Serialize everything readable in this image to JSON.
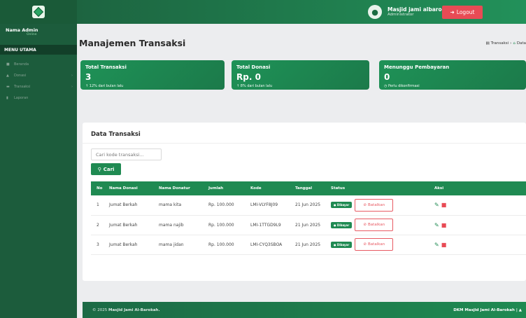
{
  "topbar": {
    "user_name": "Masjid jami albarok...",
    "user_role": "Administrator",
    "logout_label": "Logout"
  },
  "sidebar": {
    "user_panel_name": "Nama Admin",
    "user_panel_status": "Online",
    "menu_header": "MENU UTAMA",
    "items": [
      {
        "label": "Beranda",
        "icon": "dashboard-icon"
      },
      {
        "label": "Donasi",
        "icon": "donation-icon"
      },
      {
        "label": "Transaksi",
        "icon": "transaction-icon"
      },
      {
        "label": "Laporan",
        "icon": "report-icon"
      }
    ]
  },
  "page": {
    "title": "Manajemen Transaksi",
    "breadcrumb": [
      "Transaksi",
      "Data"
    ]
  },
  "cards": [
    {
      "title": "Total Transaksi",
      "value": "3",
      "note": "12% dari bulan lalu"
    },
    {
      "title": "Total Donasi",
      "value": "Rp. 0",
      "note": "8% dari bulan lalu"
    },
    {
      "title": "Menunggu Pembayaran",
      "value": "0",
      "note": "Perlu dikonfirmasi"
    }
  ],
  "panel": {
    "title": "Data Transaksi",
    "search_placeholder": "Cari kode transaksi...",
    "search_button": "Cari"
  },
  "table": {
    "headers": [
      "No",
      "Nama Donasi",
      "Nama Donatur",
      "Jumlah",
      "Kode",
      "Tanggal",
      "Status",
      "Aksi"
    ],
    "rows": [
      {
        "no": "1",
        "donasi": "Jumat Berkah",
        "donatur": "mama kita",
        "jumlah": "Rp. 100.000",
        "kode": "LMI-VLYF8J09",
        "tanggal": "21 Jun 2025",
        "status": "Dibayar",
        "cancel": "Batalkan"
      },
      {
        "no": "2",
        "donasi": "Jumat Berkah",
        "donatur": "mama najib",
        "jumlah": "Rp. 100.000",
        "kode": "LMI-1TTGD9L9",
        "tanggal": "21 Jun 2025",
        "status": "Dibayar",
        "cancel": "Batalkan"
      },
      {
        "no": "3",
        "donasi": "Jumat Berkah",
        "donatur": "mama jidan",
        "jumlah": "Rp. 100.000",
        "kode": "LMI-CYQ3SBOA",
        "tanggal": "21 Jun 2025",
        "status": "Dibayar",
        "cancel": "Batalkan"
      }
    ]
  },
  "footer": {
    "copyright": "© 2025",
    "org": "Masjid Jami Al-Barokah.",
    "right": "DKM Masjid Jami Al-Barokah |"
  },
  "colors": {
    "brand_green": "#1f8a52",
    "sidebar_green": "#1c5c3c",
    "danger_red": "#e84b55"
  }
}
